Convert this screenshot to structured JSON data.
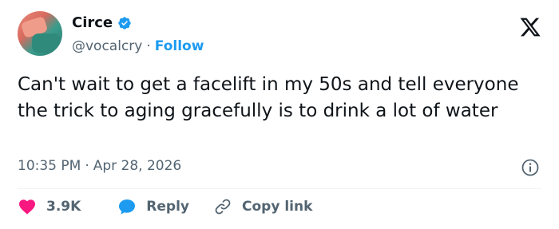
{
  "author": {
    "name": "Circe",
    "handle": "@vocalcry",
    "separator": "·",
    "follow_label": "Follow",
    "verified": true
  },
  "tweet": {
    "text": "Can't wait to get a facelift in my 50s and tell everyone the trick to aging gracefully is to drink a lot of water",
    "time": "10:35 PM",
    "separator": "·",
    "date": "Apr 28, 2026"
  },
  "actions": {
    "likes": "3.9K",
    "reply_label": "Reply",
    "copy_link_label": "Copy link"
  },
  "colors": {
    "accent": "#1d9bf0",
    "like": "#f91880",
    "muted": "#536471",
    "text": "#0f1419"
  },
  "icons": [
    "verified-badge-icon",
    "x-logo-icon",
    "info-icon",
    "heart-icon",
    "speech-bubble-icon",
    "link-icon"
  ]
}
